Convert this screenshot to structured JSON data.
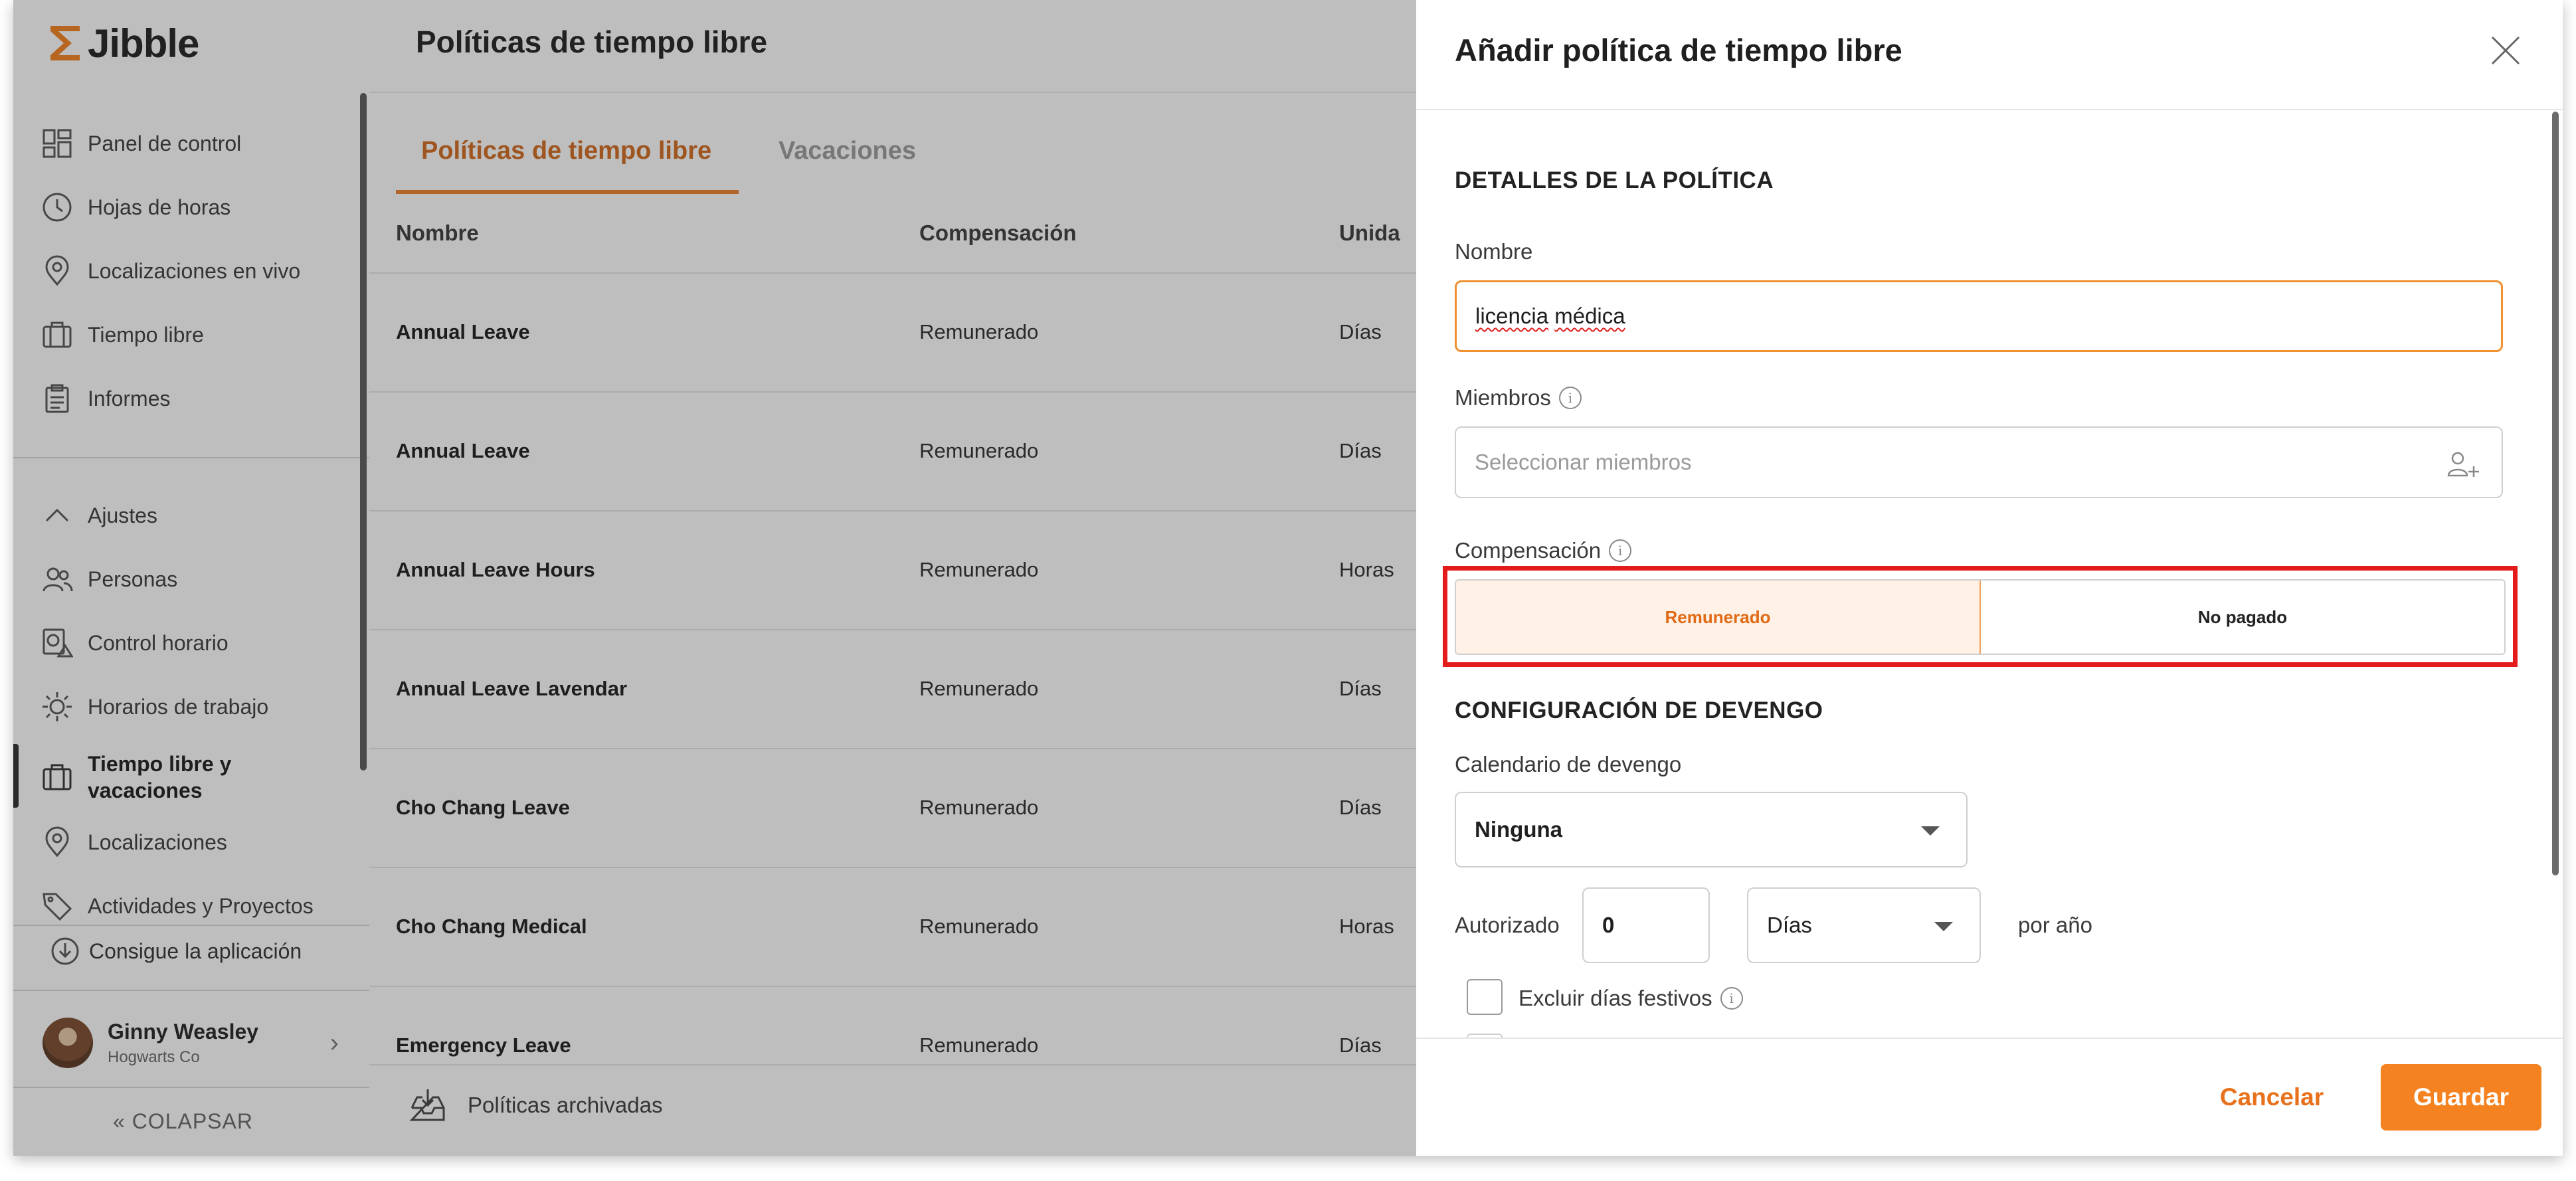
{
  "app": {
    "brand": "Jibble"
  },
  "sidebar": {
    "items": [
      {
        "label": "Panel de control",
        "icon": "dashboard-icon"
      },
      {
        "label": "Hojas de horas",
        "icon": "clock-icon"
      },
      {
        "label": "Localizaciones en vivo",
        "icon": "location-pin-icon"
      },
      {
        "label": "Tiempo libre",
        "icon": "briefcase-icon"
      },
      {
        "label": "Informes",
        "icon": "clipboard-icon"
      }
    ],
    "settings_label": "Ajustes",
    "settings_items": [
      {
        "label": "Personas",
        "icon": "people-icon"
      },
      {
        "label": "Control horario",
        "icon": "time-tracking-icon"
      },
      {
        "label": "Horarios de trabajo",
        "icon": "work-schedule-icon"
      },
      {
        "label": "Tiempo libre y vacaciones",
        "icon": "briefcase-icon"
      },
      {
        "label": "Localizaciones",
        "icon": "location-pin-icon"
      },
      {
        "label": "Actividades y Proyectos",
        "icon": "tag-icon"
      }
    ],
    "get_app": "Consigue la aplicación",
    "user": {
      "name": "Ginny Weasley",
      "org": "Hogwarts Co"
    },
    "collapse": "COLAPSAR"
  },
  "main": {
    "title": "Políticas de tiempo libre",
    "tabs": [
      {
        "label": "Políticas de tiempo libre"
      },
      {
        "label": "Vacaciones"
      }
    ],
    "columns": [
      "Nombre",
      "Compensación",
      "Unida"
    ],
    "rows": [
      {
        "name": "Annual Leave",
        "comp": "Remunerado",
        "unit": "Días"
      },
      {
        "name": "Annual Leave",
        "comp": "Remunerado",
        "unit": "Días"
      },
      {
        "name": "Annual Leave Hours",
        "comp": "Remunerado",
        "unit": "Horas"
      },
      {
        "name": "Annual Leave Lavendar",
        "comp": "Remunerado",
        "unit": "Días"
      },
      {
        "name": "Cho Chang Leave",
        "comp": "Remunerado",
        "unit": "Días"
      },
      {
        "name": "Cho Chang Medical",
        "comp": "Remunerado",
        "unit": "Horas"
      },
      {
        "name": "Emergency Leave",
        "comp": "Remunerado",
        "unit": "Días"
      }
    ],
    "archived": "Políticas archivadas"
  },
  "drawer": {
    "title": "Añadir política de tiempo libre",
    "section_details": "DETALLES DE LA POLÍTICA",
    "name_label": "Nombre",
    "name_word1": "licencia",
    "name_word2": "médica",
    "members_label": "Miembros",
    "members_placeholder": "Seleccionar miembros",
    "comp_label": "Compensación",
    "comp_options": [
      "Remunerado",
      "No pagado"
    ],
    "section_accrual": "CONFIGURACIÓN DE DEVENGO",
    "accrual_label": "Calendario de devengo",
    "accrual_value": "Ninguna",
    "authorized_label": "Autorizado",
    "authorized_value": "0",
    "unit_value": "Días",
    "per_year": "por año",
    "exclude_holidays": "Excluir días festivos",
    "cancel": "Cancelar",
    "save": "Guardar"
  },
  "colors": {
    "accent": "#f58220",
    "accent_text": "#e06a16",
    "highlight": "#e41b1b"
  }
}
